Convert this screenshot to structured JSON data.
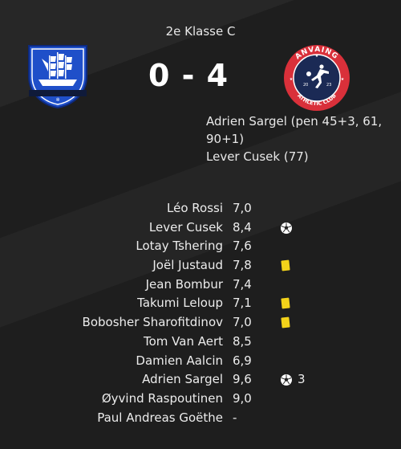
{
  "match": {
    "competition": "2e Klasse C",
    "score": "0 - 4",
    "away_crest_text": {
      "top": "ANVAING",
      "bottom": "ATHLETIC CLUB",
      "year_left": "20",
      "year_right": "23"
    },
    "scorers": [
      "Adrien Sargel (pen 45+3, 61, 90+1)",
      "Lever Cusek (77)"
    ]
  },
  "ratings": [
    {
      "name": "Léo Rossi",
      "rating": "7,0",
      "event": "",
      "count": ""
    },
    {
      "name": "Lever Cusek",
      "rating": "8,4",
      "event": "goal-icon",
      "count": ""
    },
    {
      "name": "Lotay Tshering",
      "rating": "7,6",
      "event": "",
      "count": ""
    },
    {
      "name": "Joël Justaud",
      "rating": "7,8",
      "event": "yellow-card-icon",
      "count": ""
    },
    {
      "name": "Jean Bombur",
      "rating": "7,4",
      "event": "",
      "count": ""
    },
    {
      "name": "Takumi Leloup",
      "rating": "7,1",
      "event": "yellow-card-icon",
      "count": ""
    },
    {
      "name": "Bobosher Sharofitdinov",
      "rating": "7,0",
      "event": "yellow-card-icon",
      "count": ""
    },
    {
      "name": "Tom Van Aert",
      "rating": "8,5",
      "event": "",
      "count": ""
    },
    {
      "name": "Damien Aalcin",
      "rating": "6,9",
      "event": "",
      "count": ""
    },
    {
      "name": "Adrien Sargel",
      "rating": "9,6",
      "event": "goal-icon",
      "count": "3"
    },
    {
      "name": "Øyvind Raspoutinen",
      "rating": "9,0",
      "event": "",
      "count": ""
    },
    {
      "name": "Paul Andreas Goëthe",
      "rating": "-",
      "event": "",
      "count": ""
    }
  ],
  "colors": {
    "background": "#1e1e1e",
    "home_blue": "#1f4fc9",
    "away_navy": "#1b2a55",
    "away_red": "#d9303a",
    "yellow_card": "#f2d21a"
  }
}
